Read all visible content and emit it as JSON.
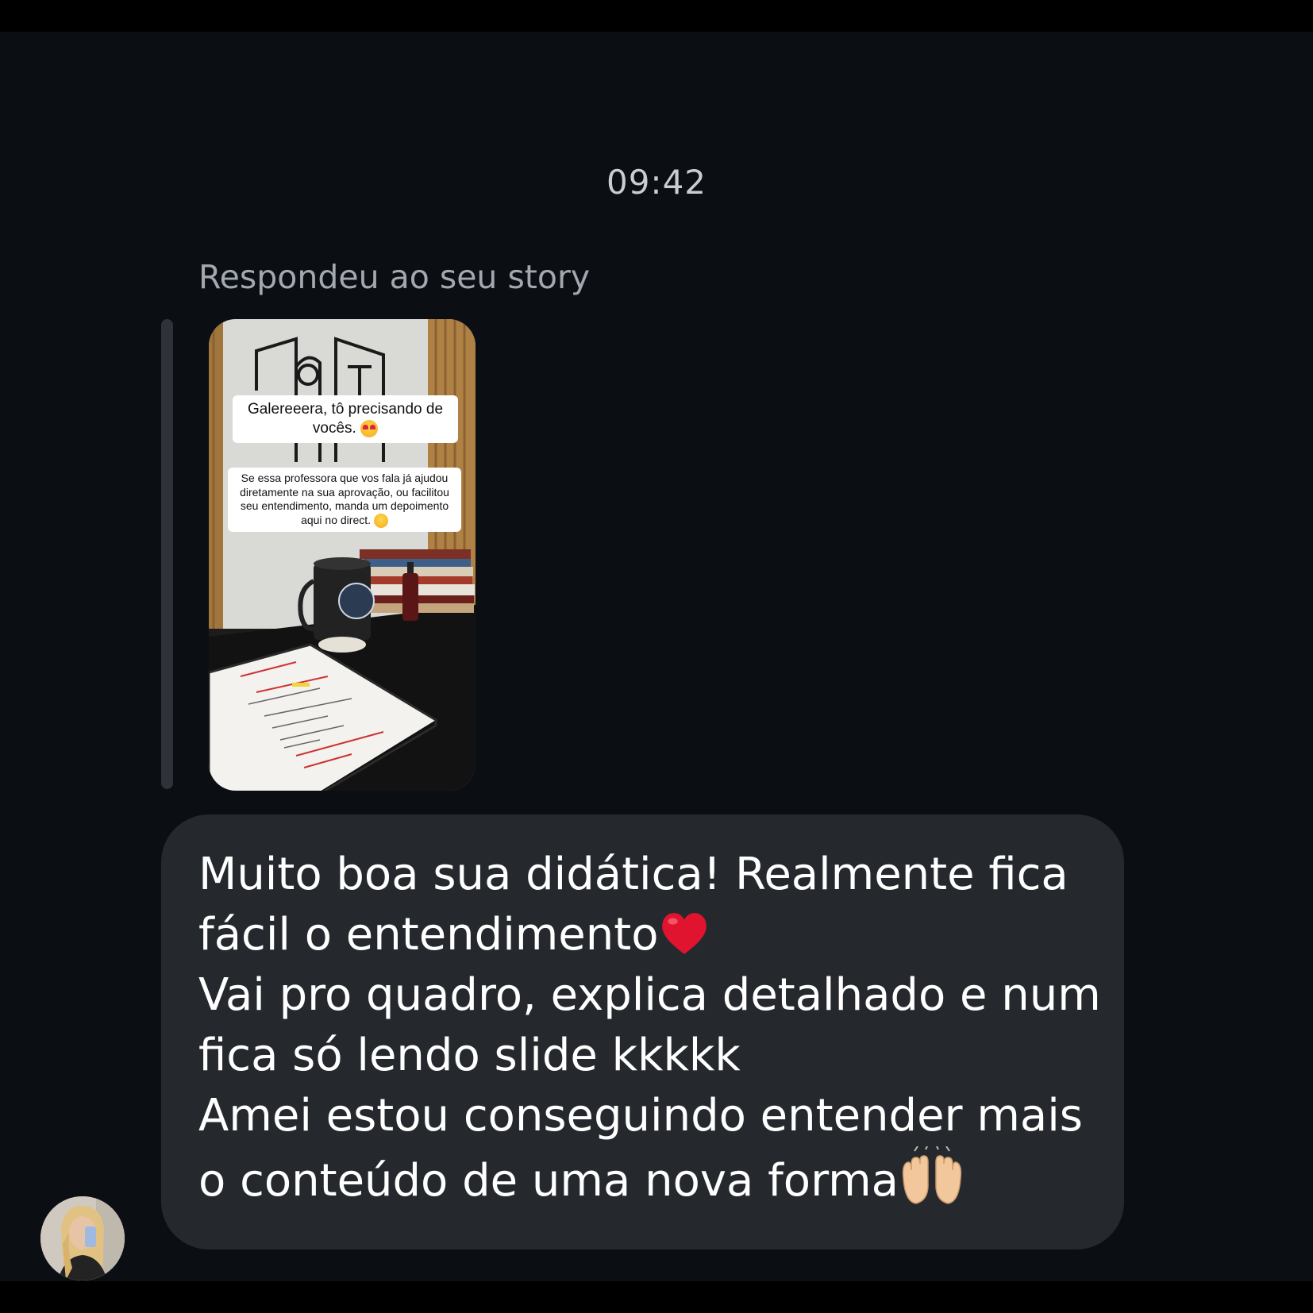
{
  "chat": {
    "timestamp": "09:42",
    "reply_label": "Respondeu ao seu story",
    "story": {
      "caption_main": "Galereeera, tô precisando de vocês.",
      "caption_sub": "Se essa professora que vos fala já ajudou diretamente na sua aprovação, ou facilitou seu entendimento, manda um depoimento aqui no direct.",
      "emoji_main": "heart-eyes-emoji",
      "emoji_sub": "star-struck-emoji"
    },
    "message": {
      "line1": "Muito boa sua didática! Realmente fica",
      "line2": "fácil o entendimento",
      "line3": "Vai pro quadro, explica detalhado e num",
      "line4": "fica só lendo slide kkkkk",
      "line5": "Amei estou conseguindo entender mais",
      "line6": "o conteúdo de uma nova forma",
      "emoji_line2": "red-heart-emoji",
      "emoji_line6": "raising-hands-emoji"
    },
    "sender_avatar": "sender-avatar"
  },
  "colors": {
    "background": "#0b0f14",
    "bubble": "#25292e",
    "text": "#ffffff",
    "muted": "#a3a8b0"
  }
}
